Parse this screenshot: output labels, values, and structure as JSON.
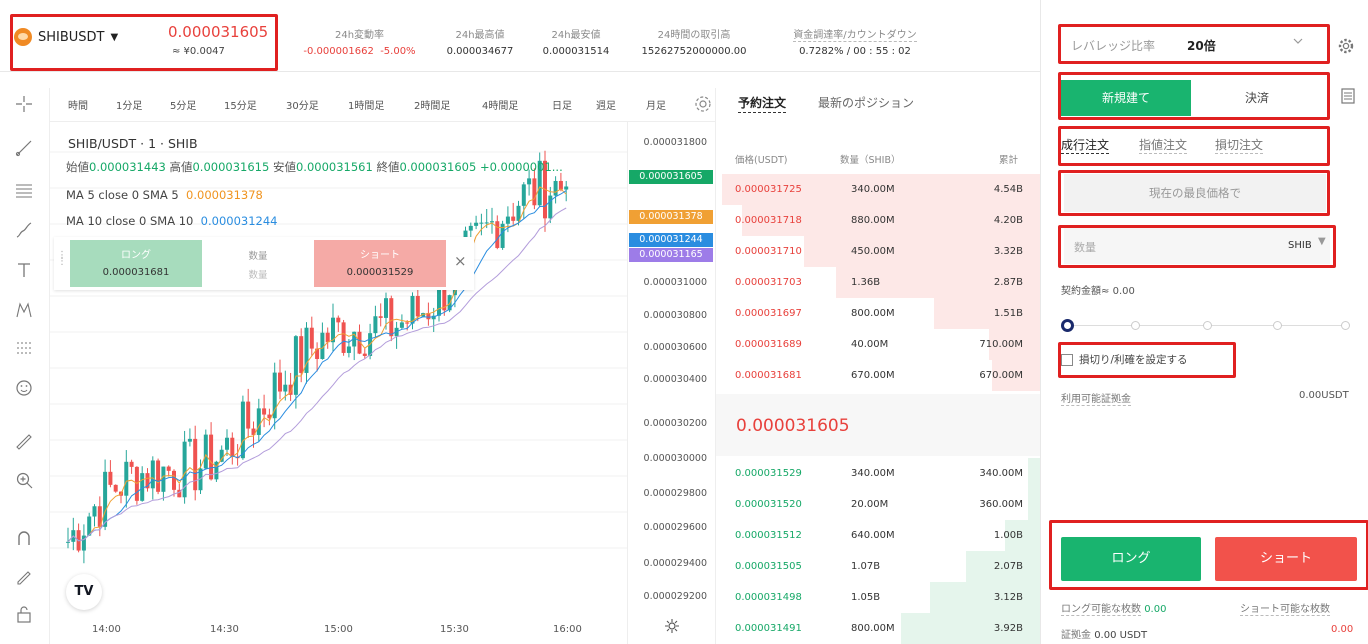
{
  "ticker": {
    "symbol": "SHIBUSDT",
    "price": "0.000031605",
    "price_jpy": "≈ ¥0.0047",
    "stats": [
      {
        "label": "24h変動率",
        "value": "-0.000001662",
        "value2": "-5.00%"
      },
      {
        "label": "24h最高値",
        "value": "0.000034677"
      },
      {
        "label": "24h最安値",
        "value": "0.000031514"
      },
      {
        "label": "24時間の取引高",
        "value": "15262752000000.00"
      },
      {
        "label": "資金調達率/カウントダウン",
        "value": "0.7282% / 00 : 55 : 02"
      }
    ]
  },
  "intervals": [
    "時間",
    "1分足",
    "5分足",
    "15分足",
    "30分足",
    "1時間足",
    "2時間足",
    "4時間足",
    "日足",
    "週足",
    "月足"
  ],
  "chart": {
    "title": "SHIB/USDT · 1 · SHIB",
    "ohlc": [
      {
        "label": "始値",
        "value": "0.000031443"
      },
      {
        "label": "高値",
        "value": "0.000031615"
      },
      {
        "label": "安値",
        "value": "0.000031561"
      },
      {
        "label": "終値",
        "value": "0.000031605"
      },
      {
        "label": "",
        "value": "+0.0000001..."
      }
    ],
    "ma5": {
      "label": "MA 5 close 0 SMA 5",
      "value": "0.000031378"
    },
    "ma10": {
      "label": "MA 10 close 0 SMA 10",
      "value": "0.000031244"
    },
    "quick_trade": {
      "long_label": "ロング",
      "long_price": "0.000031681",
      "qty_label": "数量",
      "qty_placeholder": "数量",
      "short_label": "ショート",
      "short_price": "0.000031529",
      "close": "×"
    },
    "time_labels": [
      "14:00",
      "14:30",
      "15:00",
      "15:30",
      "16:00"
    ],
    "price_labels": [
      "0.000031800",
      "0.000031000",
      "0.000030800",
      "0.000030600",
      "0.000030400",
      "0.000030200",
      "0.000030000",
      "0.000029800",
      "0.000029600",
      "0.000029400",
      "0.000029200"
    ],
    "price_tags": [
      {
        "value": "0.000031605",
        "color": "#16a867"
      },
      {
        "value": "0.000031378",
        "color": "#f0a034"
      },
      {
        "value": "0.000031244",
        "color": "#2a8de0"
      },
      {
        "value": "0.000031165",
        "color": "#9d7ce8"
      }
    ],
    "logo": "TV"
  },
  "chart_data": {
    "type": "candlestick",
    "x": [
      "14:00",
      "14:30",
      "15:00",
      "15:30",
      "16:00"
    ],
    "ylim": [
      2.92e-05,
      3.18e-05
    ],
    "last_close": 3.1605e-05,
    "ma5_last": 3.1378e-05,
    "ma10_last": 3.1244e-05
  },
  "orderbook": {
    "tabs": [
      "予約注文",
      "最新のポジション"
    ],
    "headers": [
      "価格(USDT)",
      "数量（SHIB）",
      "累計"
    ],
    "asks": [
      {
        "price": "0.000031725",
        "qty": "340.00M",
        "total": "4.54B",
        "depth": 0.98
      },
      {
        "price": "0.000031718",
        "qty": "880.00M",
        "total": "4.20B",
        "depth": 0.92
      },
      {
        "price": "0.000031710",
        "qty": "450.00M",
        "total": "3.32B",
        "depth": 0.73
      },
      {
        "price": "0.000031703",
        "qty": "1.36B",
        "total": "2.87B",
        "depth": 0.63
      },
      {
        "price": "0.000031697",
        "qty": "800.00M",
        "total": "1.51B",
        "depth": 0.33
      },
      {
        "price": "0.000031689",
        "qty": "40.00M",
        "total": "710.00M",
        "depth": 0.16
      },
      {
        "price": "0.000031681",
        "qty": "670.00M",
        "total": "670.00M",
        "depth": 0.15
      }
    ],
    "last_price": "0.000031605",
    "bids": [
      {
        "price": "0.000031529",
        "qty": "340.00M",
        "total": "340.00M",
        "depth": 0.04
      },
      {
        "price": "0.000031520",
        "qty": "20.00M",
        "total": "360.00M",
        "depth": 0.04
      },
      {
        "price": "0.000031512",
        "qty": "640.00M",
        "total": "1.00B",
        "depth": 0.11
      },
      {
        "price": "0.000031505",
        "qty": "1.07B",
        "total": "2.07B",
        "depth": 0.23
      },
      {
        "price": "0.000031498",
        "qty": "1.05B",
        "total": "3.12B",
        "depth": 0.34
      },
      {
        "price": "0.000031491",
        "qty": "800.00M",
        "total": "3.92B",
        "depth": 0.43
      }
    ]
  },
  "panel": {
    "leverage_label": "レバレッジ比率",
    "leverage_value": "20倍",
    "tab_open": "新規建て",
    "tab_close": "決済",
    "order_types": [
      "成行注文",
      "指値注文",
      "損切注文"
    ],
    "best_price": "現在の最良価格で",
    "qty_placeholder": "数量",
    "qty_unit": "SHIB",
    "contract_label": "契約金額≈",
    "contract_value": "0.00",
    "tpsl_label": "損切り/利確を設定する",
    "margin_label": "利用可能証拠金",
    "margin_value": "0.00USDT",
    "long_btn": "ロング",
    "short_btn": "ショート",
    "long_avail_label": "ロング可能な枚数",
    "long_avail_value": "0.00",
    "short_avail_label": "ショート可能な枚数",
    "deposit_label": "証拠金",
    "deposit_value": "0.00 USDT",
    "short_deposit_value": "0.00"
  }
}
